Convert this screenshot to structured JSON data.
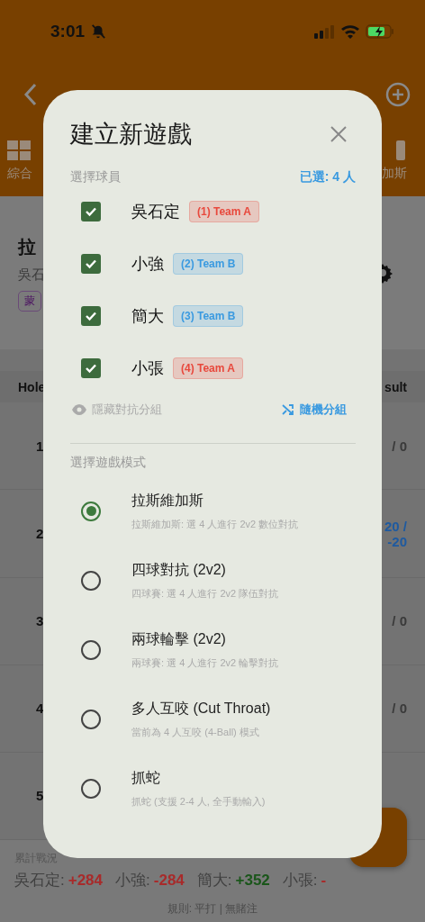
{
  "status_bar": {
    "time": "3:01"
  },
  "tabs": [
    {
      "label": "綜合"
    },
    {
      "label": "加斯"
    }
  ],
  "game_card": {
    "title": "拉",
    "players": "吳石",
    "tag": "蒙"
  },
  "table": {
    "columns": [
      "Hole",
      "sult"
    ],
    "rows": [
      {
        "hole": "1",
        "result": [
          "/ 0"
        ],
        "color": "#3a3a3a"
      },
      {
        "hole": "2",
        "result": [
          "20 /",
          "-20"
        ],
        "color": "#1e5aa0"
      },
      {
        "hole": "3",
        "result": [
          "/ 0"
        ],
        "color": "#3a3a3a"
      },
      {
        "hole": "4",
        "result": [
          "/ 0"
        ],
        "color": "#3a3a3a"
      },
      {
        "hole": "5",
        "result": []
      }
    ]
  },
  "summary": {
    "label": "累計戰況",
    "scores": [
      {
        "name": "吳石定:",
        "value": "+284",
        "color": "#a82a2a"
      },
      {
        "name": "小強:",
        "value": "-284",
        "color": "#a82a2a"
      },
      {
        "name": "簡大:",
        "value": "+352",
        "color": "#1a561a"
      },
      {
        "name": "小張:",
        "value": "-",
        "color": "#a82a2a"
      }
    ],
    "rules": "規則: 平打 | 無賭注"
  },
  "dialog": {
    "title": "建立新遊戲",
    "players_label": "選擇球員",
    "selected_count": "已選: 4 人",
    "players": [
      {
        "name": "吳石定",
        "tag": "(1) Team A",
        "color": "#e8483c",
        "checked": true
      },
      {
        "name": "小強",
        "tag": "(2) Team B",
        "color": "#3a9ae0",
        "checked": true
      },
      {
        "name": "簡大",
        "tag": "(3) Team B",
        "color": "#3a9ae0",
        "checked": true
      },
      {
        "name": "小張",
        "tag": "(4) Team A",
        "color": "#e8483c",
        "checked": true
      }
    ],
    "hide_teams": "隱藏對抗分組",
    "shuffle": "隨機分組",
    "modes_label": "選擇遊戲模式",
    "modes": [
      {
        "title": "拉斯維加斯",
        "description": "拉斯維加斯: 選 4 人進行 2v2 數位對抗",
        "selected": true
      },
      {
        "title": "四球對抗 (2v2)",
        "description": "四球賽: 選 4 人進行 2v2 隊伍對抗",
        "selected": false
      },
      {
        "title": "兩球輪擊 (2v2)",
        "description": "兩球賽: 選 4 人進行 2v2 輪擊對抗",
        "selected": false
      },
      {
        "title": "多人互咬 (Cut Throat)",
        "description": "當前為 4 人互咬 (4-Ball) 模式",
        "selected": false
      },
      {
        "title": "抓蛇",
        "description": "抓蛇 (支援 2-4 人, 全手動輸入)",
        "selected": false
      }
    ]
  }
}
